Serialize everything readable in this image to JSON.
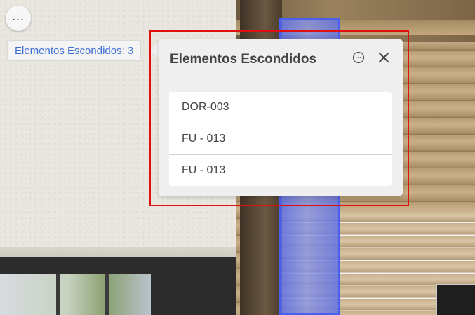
{
  "menu": {
    "icon": "more-horizontal-icon",
    "glyph": "..."
  },
  "hidden_badge": {
    "text": "Elementos Escondidos: 3"
  },
  "panel": {
    "title": "Elementos Escondidos",
    "options_glyph": "...",
    "items": [
      {
        "label": "DOR-003"
      },
      {
        "label": "FU - 013"
      },
      {
        "label": "FU - 013"
      }
    ]
  },
  "colors": {
    "accent_link": "#3f6fd6",
    "selection_blue": "#4b5ef2",
    "highlight_frame": "#e01010"
  }
}
